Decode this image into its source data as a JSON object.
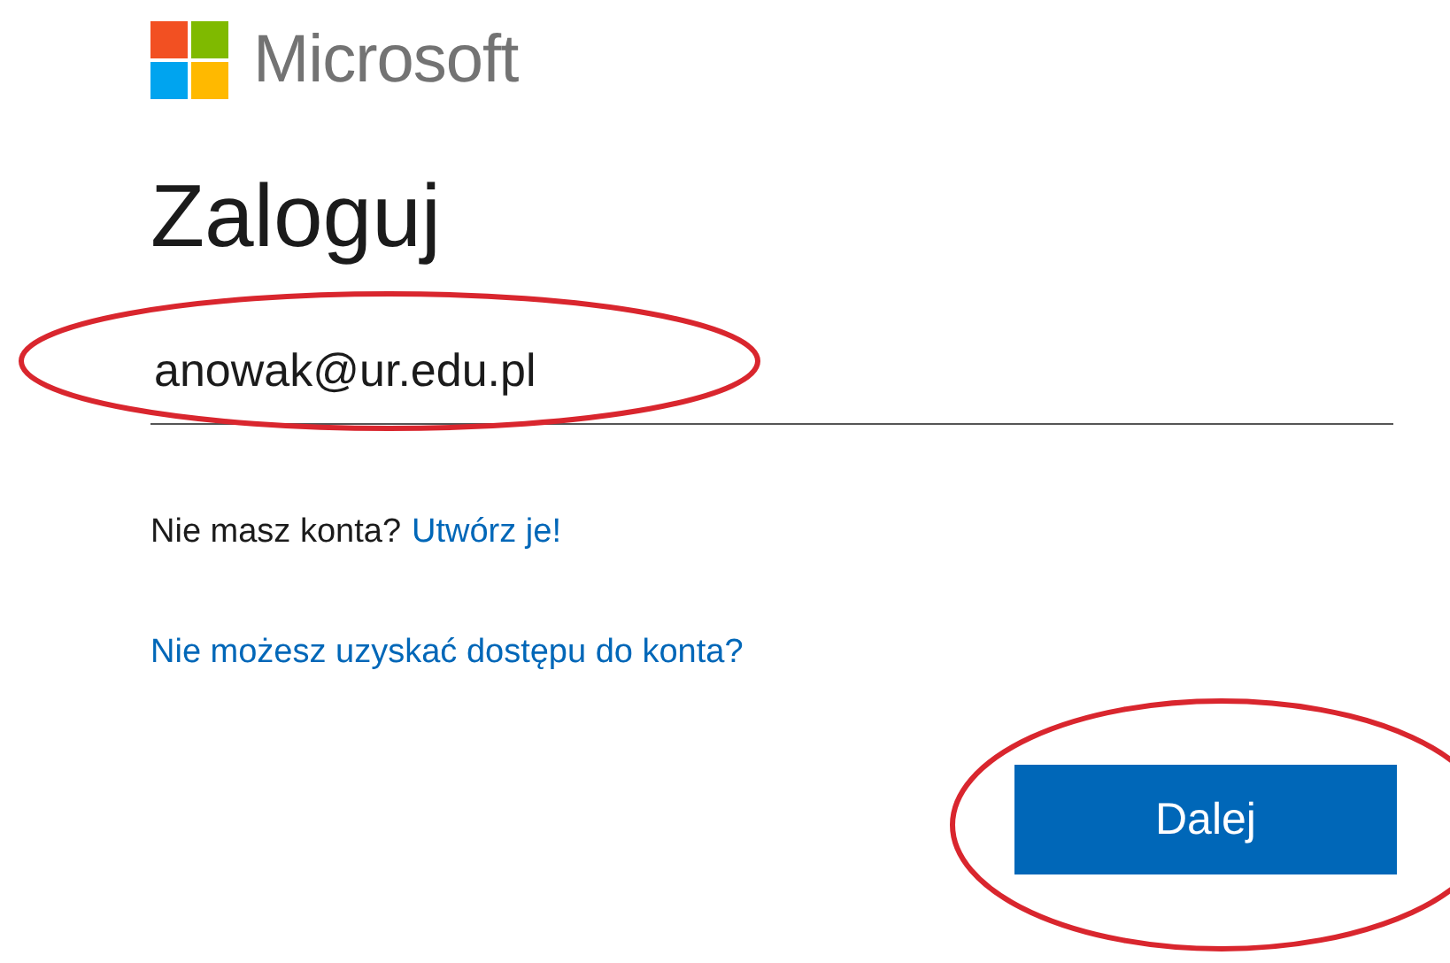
{
  "brand": {
    "name": "Microsoft"
  },
  "title": "Zaloguj",
  "email_field": {
    "value": "anowak@ur.edu.pl"
  },
  "no_account": {
    "text": "Nie masz konta?",
    "link": "Utwórz je!"
  },
  "access_link": "Nie możesz uzyskać dostępu do konta?",
  "buttons": [
    {
      "label": "Dalej"
    }
  ]
}
